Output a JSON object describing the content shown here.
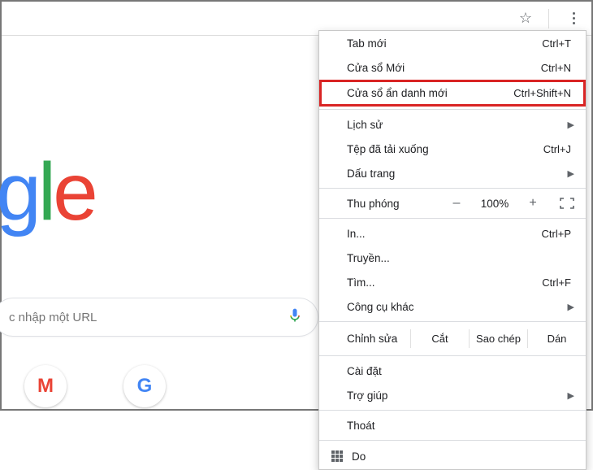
{
  "toolbar": {
    "star_title": "Bookmark",
    "menu_title": "Customize and control Google Chrome"
  },
  "page": {
    "logo_text": "oogle",
    "search_placeholder": "c nhập một URL",
    "apps": [
      {
        "name": "Gmail"
      },
      {
        "name": "Google"
      }
    ]
  },
  "menu": {
    "new_tab": {
      "label": "Tab mới",
      "shortcut": "Ctrl+T"
    },
    "new_window": {
      "label": "Cửa sổ Mới",
      "shortcut": "Ctrl+N"
    },
    "incognito": {
      "label": "Cửa sổ ẩn danh mới",
      "shortcut": "Ctrl+Shift+N"
    },
    "history": {
      "label": "Lịch sử"
    },
    "downloads": {
      "label": "Tệp đã tải xuống",
      "shortcut": "Ctrl+J"
    },
    "bookmarks": {
      "label": "Dấu trang"
    },
    "zoom": {
      "label": "Thu phóng",
      "minus": "–",
      "value": "100%",
      "plus": "+"
    },
    "print": {
      "label": "In...",
      "shortcut": "Ctrl+P"
    },
    "cast": {
      "label": "Truyền..."
    },
    "find": {
      "label": "Tìm...",
      "shortcut": "Ctrl+F"
    },
    "more_tools": {
      "label": "Công cụ khác"
    },
    "edit": {
      "label": "Chỉnh sửa",
      "cut": "Cắt",
      "copy": "Sao chép",
      "paste": "Dán"
    },
    "settings": {
      "label": "Cài đặt"
    },
    "help": {
      "label": "Trợ giúp"
    },
    "exit": {
      "label": "Thoát"
    },
    "profile": {
      "label": "Do"
    }
  }
}
